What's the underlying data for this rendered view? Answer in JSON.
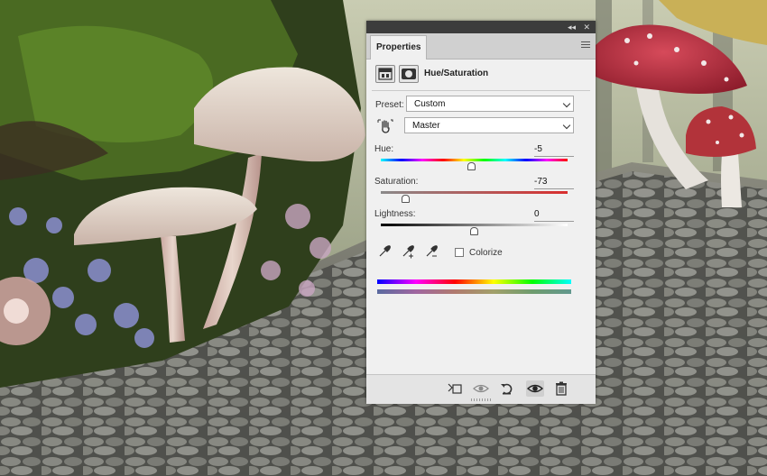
{
  "panel": {
    "tab_label": "Properties",
    "title": "Hue/Saturation",
    "collapse_icon": "double-chevron-icon",
    "close_icon": "close-icon",
    "collapse_glyph": "◂◂",
    "close_glyph": "✕"
  },
  "preset": {
    "label": "Preset:",
    "value": "Custom"
  },
  "channel": {
    "value": "Master"
  },
  "hue": {
    "label": "Hue:",
    "value": "-5",
    "level": -5,
    "min": -180,
    "max": 180
  },
  "saturation": {
    "label": "Saturation:",
    "value": "-73",
    "level": -73,
    "min": -100,
    "max": 100
  },
  "lightness": {
    "label": "Lightness:",
    "value": "0",
    "level": 0,
    "min": -100,
    "max": 100
  },
  "colorize": {
    "label": "Colorize",
    "checked": false
  },
  "colors": {
    "panel_bg": "#f0f0f0",
    "tab_bar": "#d0d0d0",
    "title_bar": "#3c3c3c"
  }
}
